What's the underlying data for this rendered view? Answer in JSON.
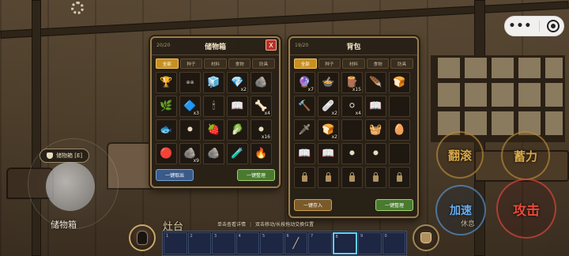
{
  "storage": {
    "count": "20/20",
    "title": "储物箱",
    "close_label": "X",
    "tabs": [
      "全部",
      "种子",
      "材料",
      "食物",
      "防具"
    ],
    "active_tab": 0,
    "items": [
      {
        "icon": "🏆",
        "qty": "",
        "name": "gold-items"
      },
      {
        "icon": "",
        "text": "⊕⊕",
        "qty": "",
        "name": "chain"
      },
      {
        "icon": "🧊",
        "qty": "",
        "name": "blue-crystal-box"
      },
      {
        "icon": "💎",
        "qty": "x2",
        "name": "green-gem"
      },
      {
        "icon": "🪨",
        "qty": "",
        "name": "dark-ore"
      },
      {
        "icon": "🌿",
        "qty": "",
        "name": "green-crystal"
      },
      {
        "icon": "🔷",
        "qty": "x3",
        "name": "blue-ore"
      },
      {
        "icon": "🕯",
        "qty": "",
        "name": "candle"
      },
      {
        "icon": "📖",
        "qty": "",
        "name": "book"
      },
      {
        "icon": "🦴",
        "qty": "x4",
        "name": "bone"
      },
      {
        "icon": "🐟",
        "qty": "",
        "name": "fish"
      },
      {
        "icon": "⚫",
        "qty": "",
        "name": "coal"
      },
      {
        "icon": "🍓",
        "qty": "",
        "name": "berries"
      },
      {
        "icon": "🥬",
        "qty": "",
        "name": "radish"
      },
      {
        "icon": "⚫",
        "qty": "x16",
        "name": "coal-stack"
      },
      {
        "icon": "🔴",
        "qty": "",
        "name": "red-gem"
      },
      {
        "icon": "🪨",
        "qty": "x9",
        "name": "stone"
      },
      {
        "icon": "🪨",
        "qty": "",
        "name": "gray-ore"
      },
      {
        "icon": "🧪",
        "qty": "",
        "name": "crystal-flask"
      },
      {
        "icon": "🔥",
        "qty": "",
        "name": "orange-ore"
      }
    ],
    "take_all_label": "一键取出",
    "sort_label": "一键整理"
  },
  "backpack": {
    "count": "19/20",
    "title": "背包",
    "tabs": [
      "全部",
      "种子",
      "材料",
      "食物",
      "防具"
    ],
    "active_tab": 0,
    "items": [
      {
        "icon": "🔮",
        "qty": "x7",
        "name": "blue-orb"
      },
      {
        "icon": "🍲",
        "qty": "",
        "name": "stew-bowl"
      },
      {
        "icon": "🪵",
        "qty": "x15",
        "name": "logs"
      },
      {
        "icon": "🪶",
        "qty": "",
        "name": "feather"
      },
      {
        "icon": "🍞",
        "qty": "",
        "name": "bread-plate"
      },
      {
        "icon": "🔨",
        "qty": "",
        "name": "torch"
      },
      {
        "icon": "🩹",
        "qty": "x2",
        "name": "bandage"
      },
      {
        "icon": "⚪",
        "qty": "x4",
        "name": "cotton"
      },
      {
        "icon": "📖",
        "qty": "",
        "name": "book"
      },
      {
        "icon": "",
        "qty": "",
        "name": "empty"
      },
      {
        "icon": "🗡",
        "qty": "",
        "name": "spear"
      },
      {
        "icon": "🍞",
        "qty": "x2",
        "name": "bread"
      },
      {
        "icon": "",
        "qty": "",
        "name": "empty"
      },
      {
        "icon": "🧺",
        "qty": "",
        "name": "basket"
      },
      {
        "icon": "🥚",
        "qty": "",
        "name": "egg"
      },
      {
        "icon": "📖",
        "qty": "",
        "name": "book-2"
      },
      {
        "icon": "📖",
        "qty": "",
        "name": "book-3"
      },
      {
        "icon": "⚫",
        "qty": "",
        "name": "coal"
      },
      {
        "icon": "⚫",
        "qty": "",
        "name": "coal-2"
      },
      {
        "icon": "",
        "qty": "",
        "name": "empty"
      },
      {
        "locked": true
      },
      {
        "locked": true
      },
      {
        "locked": true
      },
      {
        "locked": true
      },
      {
        "locked": true
      }
    ],
    "store_all_label": "一键存入",
    "sort_label": "一键整理"
  },
  "hud": {
    "storage_hint": "储物箱 [E]",
    "storage_label": "储物箱",
    "player_name": "灶台",
    "hint_left": "单击查看详情",
    "hint_sep": "|",
    "hint_right": "双击移动/长按拖动交换位置",
    "actions": {
      "roll": "翻滚",
      "charge": "蓄力",
      "speed": "加速",
      "attack": "攻击",
      "rest": "休息"
    },
    "hotbar": [
      {
        "num": "1",
        "icon": ""
      },
      {
        "num": "2",
        "icon": ""
      },
      {
        "num": "3",
        "icon": ""
      },
      {
        "num": "4",
        "icon": ""
      },
      {
        "num": "5",
        "icon": ""
      },
      {
        "num": "6",
        "icon": "╱"
      },
      {
        "num": "7",
        "icon": ""
      },
      {
        "num": "8",
        "icon": "",
        "selected": true
      },
      {
        "num": "9",
        "icon": ""
      },
      {
        "num": "0",
        "icon": ""
      }
    ],
    "capsule_dots": "•••"
  }
}
